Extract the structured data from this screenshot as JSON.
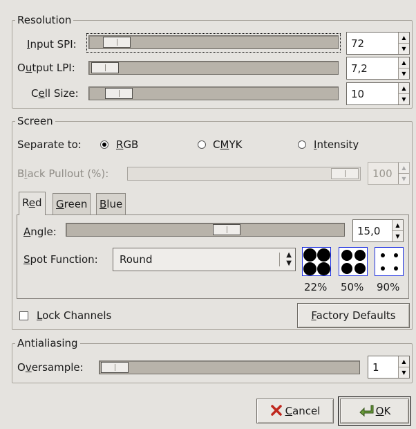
{
  "resolution": {
    "title": "Resolution",
    "input_spi": {
      "label_pre": "",
      "label_mn": "I",
      "label_post": "nput SPI:",
      "value": "72",
      "slider_fraction": 0.035
    },
    "output_lpi": {
      "label_pre": "O",
      "label_mn": "u",
      "label_post": "tput LPI:",
      "value": "7,2",
      "slider_fraction": 0.02
    },
    "cell_size": {
      "label_pre": "C",
      "label_mn": "e",
      "label_post": "ll Size:",
      "value": "10",
      "slider_fraction": 0.065
    }
  },
  "screen": {
    "title": "Screen",
    "separate_to_label": "Separate to:",
    "options": [
      {
        "pre": "",
        "mn": "R",
        "post": "GB",
        "selected": true
      },
      {
        "pre": "C",
        "mn": "M",
        "post": "YK",
        "selected": false
      },
      {
        "pre": "",
        "mn": "I",
        "post": "ntensity",
        "selected": false
      }
    ],
    "black_pullout": {
      "pre": "B",
      "mn": "l",
      "post": "ack Pullout (%):",
      "value": "100",
      "slider_fraction": 1.0,
      "disabled": true
    },
    "tabs": [
      {
        "pre": "R",
        "mn": "e",
        "post": "d",
        "active": true
      },
      {
        "pre": "",
        "mn": "G",
        "post": "reen",
        "active": false
      },
      {
        "pre": "",
        "mn": "B",
        "post": "lue",
        "active": false
      }
    ],
    "angle": {
      "pre": "",
      "mn": "A",
      "post": "ngle:",
      "value": "15,0",
      "slider_fraction": 0.58
    },
    "spot_function": {
      "pre": "",
      "mn": "S",
      "post": "pot Function:",
      "value": "Round"
    },
    "previews": [
      "22%",
      "50%",
      "90%"
    ],
    "lock_channels": {
      "pre": "",
      "mn": "L",
      "post": "ock Channels",
      "checked": false
    },
    "factory_defaults": {
      "pre": "",
      "mn": "F",
      "post": "actory Defaults"
    }
  },
  "antialiasing": {
    "title": "Antialiasing",
    "oversample": {
      "pre": "O",
      "mn": "v",
      "post": "ersample:",
      "value": "1",
      "slider_fraction": 0.0
    }
  },
  "buttons": {
    "cancel": {
      "pre": "",
      "mn": "C",
      "post": "ancel"
    },
    "ok": {
      "pre": "",
      "mn": "O",
      "post": "K"
    }
  },
  "colors": {
    "accent_border": "#1a2de0",
    "cancel_icon": "#c0281e",
    "ok_icon": "#6a9a3a"
  }
}
